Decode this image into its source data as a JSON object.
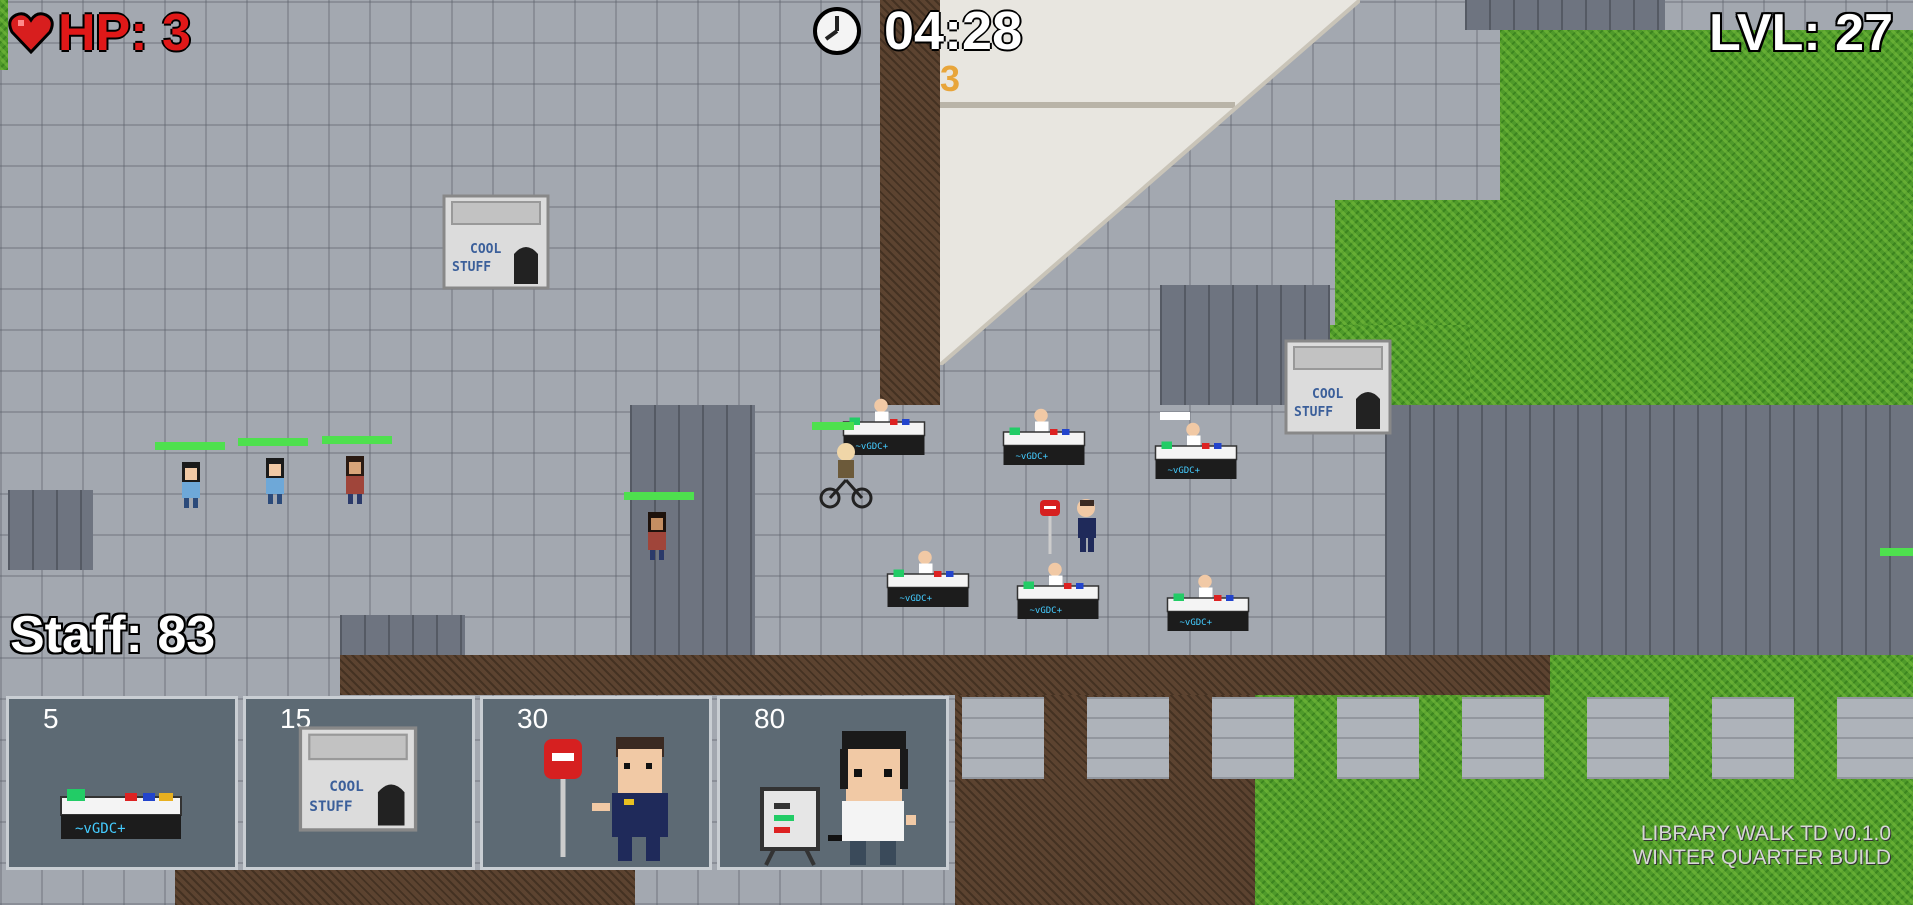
{
  "hud": {
    "hp_label": "HP: 3",
    "timer": "04:28",
    "wave_counter": "3",
    "level_label": "LVL: 27",
    "staff_label": "Staff: 83"
  },
  "tower_shop": [
    {
      "cost": "5",
      "icon": "table-booth-icon"
    },
    {
      "cost": "15",
      "icon": "cool-stuff-kiosk-icon"
    },
    {
      "cost": "30",
      "icon": "security-guard-icon"
    },
    {
      "cost": "80",
      "icon": "presenter-icon"
    }
  ],
  "kiosk_sign": {
    "line1": "COOL",
    "line2": "STUFF"
  },
  "version": {
    "line1": "LIBRARY WALK TD v0.1.0",
    "line2": "WINTER QUARTER BUILD"
  },
  "colors": {
    "hp": "#e01818",
    "health_bar": "#4ee04e",
    "grass": "#4f9a2a",
    "path": "#5c4330",
    "pavement": "#a3a8b0",
    "card_bg": "#5d6a74"
  }
}
